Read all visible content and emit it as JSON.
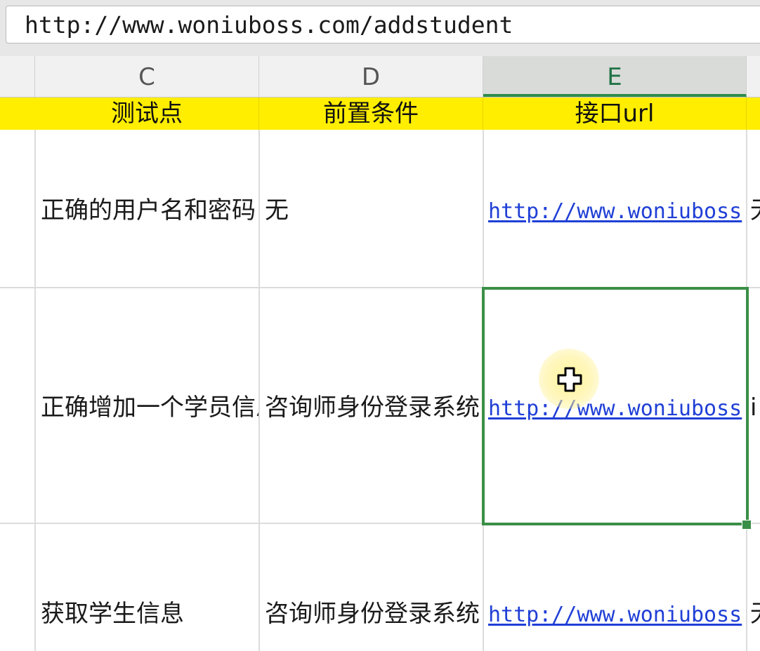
{
  "formula_bar": {
    "value": "http://www.woniuboss.com/addstudent"
  },
  "columns": [
    {
      "letter": "C",
      "header": "测试点"
    },
    {
      "letter": "D",
      "header": "前置条件"
    },
    {
      "letter": "E",
      "header": "接口url"
    }
  ],
  "rows": [
    {
      "C": "正确的用户名和密码",
      "D": "无",
      "E": "http://www.woniuboss",
      "F": "无"
    },
    {
      "C": "正确增加一个学员信息",
      "D": "咨询师身份登录系统",
      "E": "http://www.woniuboss",
      "F": "i"
    },
    {
      "C": "获取学生信息",
      "D": "咨询师身份登录系统",
      "E": "http://www.woniuboss",
      "F": "无"
    }
  ],
  "selection": {
    "cell": "E",
    "row_index": 2
  },
  "colors": {
    "header_fill": "#ffee00",
    "selection_border": "#3a8f47",
    "link": "#1f3fd6"
  },
  "icons": {
    "cursor": "cell-select-cross-icon"
  }
}
